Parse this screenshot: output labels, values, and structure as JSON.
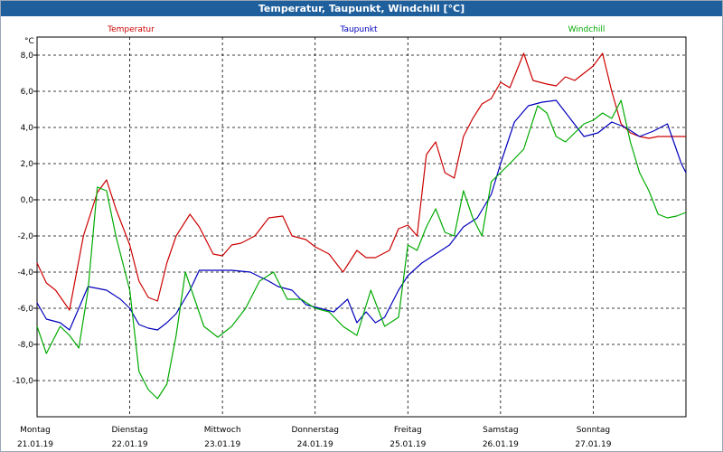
{
  "window": {
    "title": "Temperatur, Taupunkt, Windchill [°C]"
  },
  "colors": {
    "temperatur": "#cc0000",
    "taupunkt": "#0000bb",
    "windchill": "#00aa00",
    "titlebar": "#1f5f9c",
    "grid": "#000000"
  },
  "chart_data": {
    "type": "line",
    "title": "Temperatur, Taupunkt, Windchill [°C]",
    "ylabel": "°C",
    "ylim": [
      -12,
      9
    ],
    "xlim": [
      0,
      7
    ],
    "grid": true,
    "legend_position": "top",
    "y_ticks": [
      "8,0",
      "6,0",
      "4,0",
      "2,0",
      "0,0",
      "-2,0",
      "-4,0",
      "-6,0",
      "-8,0",
      "-10,0"
    ],
    "y_tick_values": [
      8,
      6,
      4,
      2,
      0,
      -2,
      -4,
      -6,
      -8,
      -10
    ],
    "x_ticks": [
      {
        "day": "Montag",
        "date": "21.01.19"
      },
      {
        "day": "Dienstag",
        "date": "22.01.19"
      },
      {
        "day": "Mittwoch",
        "date": "23.01.19"
      },
      {
        "day": "Donnerstag",
        "date": "24.01.19"
      },
      {
        "day": "Freitag",
        "date": "25.01.19"
      },
      {
        "day": "Samstag",
        "date": "26.01.19"
      },
      {
        "day": "Sonntag",
        "date": "27.01.19"
      }
    ],
    "series": [
      {
        "name": "Temperatur",
        "color": "#cc0000",
        "x": [
          0,
          0.1,
          0.2,
          0.35,
          0.5,
          0.65,
          0.75,
          0.85,
          1.0,
          1.1,
          1.2,
          1.3,
          1.4,
          1.5,
          1.65,
          1.75,
          1.9,
          2.0,
          2.1,
          2.2,
          2.35,
          2.5,
          2.65,
          2.75,
          2.9,
          3.0,
          3.15,
          3.3,
          3.45,
          3.55,
          3.65,
          3.8,
          3.9,
          4.0,
          4.1,
          4.2,
          4.3,
          4.4,
          4.5,
          4.6,
          4.7,
          4.8,
          4.9,
          5.0,
          5.1,
          5.25,
          5.35,
          5.5,
          5.6,
          5.7,
          5.8,
          5.9,
          6.0,
          6.1,
          6.2,
          6.3,
          6.4,
          6.5,
          6.6,
          6.7,
          6.8,
          6.95,
          7.0
        ],
        "y": [
          -3.5,
          -4.6,
          -5.0,
          -6.1,
          -2.0,
          0.4,
          1.1,
          -0.5,
          -2.5,
          -4.5,
          -5.4,
          -5.6,
          -3.5,
          -2.0,
          -0.8,
          -1.5,
          -3.0,
          -3.1,
          -2.5,
          -2.4,
          -2.0,
          -1.0,
          -0.9,
          -2.0,
          -2.2,
          -2.6,
          -3.0,
          -4.0,
          -2.8,
          -3.2,
          -3.2,
          -2.8,
          -1.6,
          -1.4,
          -2.0,
          2.5,
          3.2,
          1.5,
          1.2,
          3.5,
          4.5,
          5.3,
          5.6,
          6.5,
          6.2,
          8.1,
          6.6,
          6.4,
          6.3,
          6.8,
          6.6,
          7.0,
          7.4,
          8.1,
          6.0,
          4.2,
          3.7,
          3.5,
          3.4,
          3.5,
          3.5,
          3.5,
          3.5
        ]
      },
      {
        "name": "Taupunkt",
        "color": "#0000bb",
        "x": [
          0,
          0.1,
          0.25,
          0.35,
          0.45,
          0.55,
          0.65,
          0.75,
          0.9,
          1.0,
          1.1,
          1.2,
          1.3,
          1.4,
          1.5,
          1.65,
          1.75,
          1.9,
          2.1,
          2.3,
          2.5,
          2.6,
          2.75,
          2.9,
          3.05,
          3.2,
          3.35,
          3.45,
          3.55,
          3.65,
          3.75,
          3.9,
          4.0,
          4.15,
          4.3,
          4.45,
          4.6,
          4.75,
          4.9,
          5.0,
          5.15,
          5.3,
          5.45,
          5.6,
          5.75,
          5.9,
          6.05,
          6.2,
          6.35,
          6.5,
          6.65,
          6.8,
          6.95,
          7.0
        ],
        "y": [
          -5.7,
          -6.6,
          -6.8,
          -7.2,
          -6.0,
          -4.8,
          -4.9,
          -5.0,
          -5.5,
          -6.0,
          -6.9,
          -7.1,
          -7.2,
          -6.8,
          -6.3,
          -5.0,
          -3.9,
          -3.9,
          -3.9,
          -4.0,
          -4.5,
          -4.8,
          -5.0,
          -5.8,
          -6.0,
          -6.2,
          -5.5,
          -6.8,
          -6.2,
          -6.8,
          -6.5,
          -5.0,
          -4.2,
          -3.5,
          -3.0,
          -2.5,
          -1.5,
          -1.0,
          0.3,
          2.0,
          4.3,
          5.2,
          5.4,
          5.5,
          4.5,
          3.5,
          3.7,
          4.3,
          4.0,
          3.5,
          3.8,
          4.2,
          2.0,
          1.5
        ]
      },
      {
        "name": "Windchill",
        "color": "#00aa00",
        "x": [
          0,
          0.1,
          0.25,
          0.35,
          0.45,
          0.55,
          0.65,
          0.75,
          0.85,
          1.0,
          1.1,
          1.2,
          1.3,
          1.4,
          1.5,
          1.6,
          1.7,
          1.8,
          1.95,
          2.1,
          2.25,
          2.4,
          2.55,
          2.7,
          2.85,
          3.0,
          3.15,
          3.3,
          3.45,
          3.6,
          3.75,
          3.9,
          4.0,
          4.1,
          4.2,
          4.3,
          4.4,
          4.5,
          4.6,
          4.7,
          4.8,
          4.9,
          5.0,
          5.1,
          5.25,
          5.4,
          5.5,
          5.6,
          5.7,
          5.8,
          5.9,
          6.0,
          6.1,
          6.2,
          6.3,
          6.4,
          6.5,
          6.6,
          6.7,
          6.8,
          6.9,
          7.0
        ],
        "y": [
          -7.0,
          -8.5,
          -7.0,
          -7.5,
          -8.2,
          -5.0,
          0.7,
          0.5,
          -2.0,
          -5.0,
          -9.5,
          -10.5,
          -11.0,
          -10.2,
          -7.5,
          -4.0,
          -5.5,
          -7.0,
          -7.6,
          -7.0,
          -6.0,
          -4.5,
          -4.0,
          -5.5,
          -5.5,
          -6.0,
          -6.2,
          -7.0,
          -7.5,
          -5.0,
          -7.0,
          -6.5,
          -2.5,
          -2.8,
          -1.5,
          -0.5,
          -1.8,
          -2.0,
          0.5,
          -1.0,
          -2.0,
          1.0,
          1.5,
          2.0,
          2.8,
          5.2,
          4.8,
          3.5,
          3.2,
          3.7,
          4.2,
          4.4,
          4.8,
          4.5,
          5.5,
          3.2,
          1.5,
          0.5,
          -0.8,
          -1.0,
          -0.9,
          -0.7
        ]
      }
    ]
  }
}
